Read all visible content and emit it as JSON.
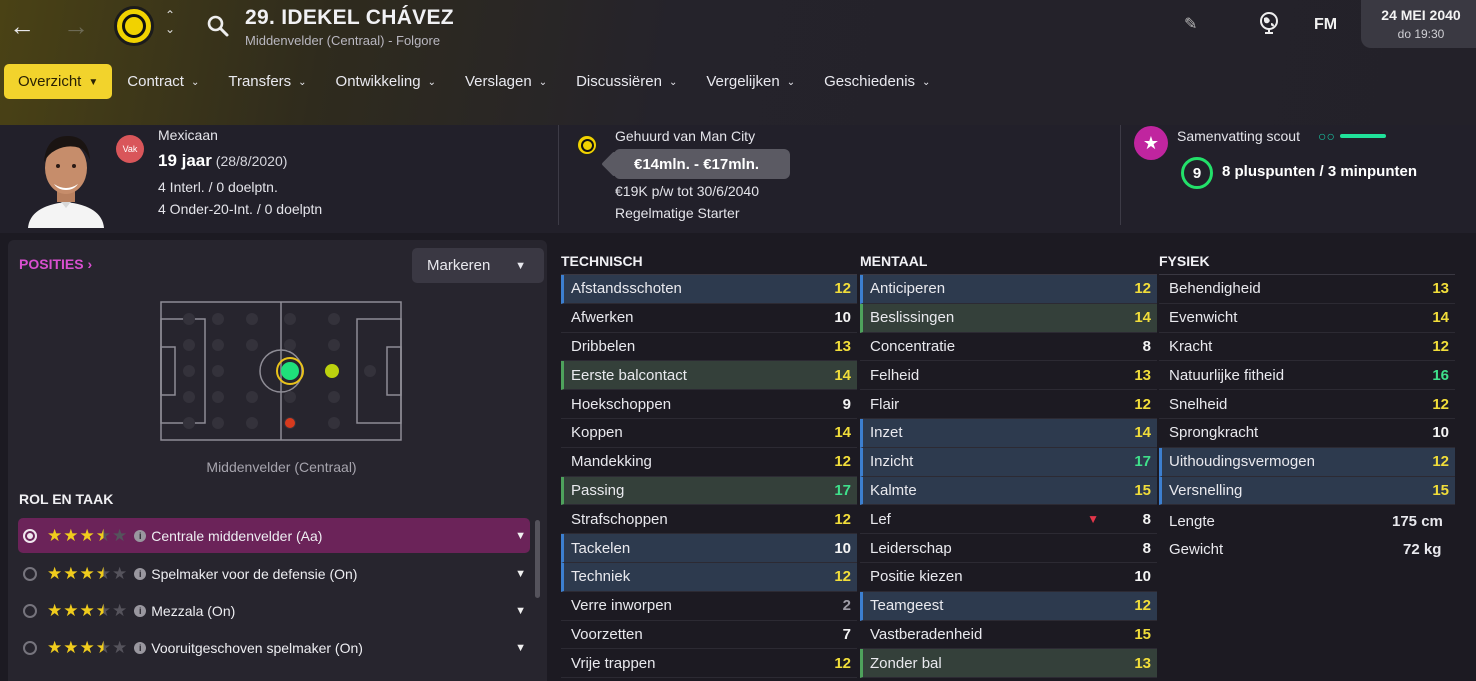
{
  "header": {
    "player_name": "29. IDEKEL CHÁVEZ",
    "player_sub": "Middenvelder (Centraal) - Folgore",
    "fm_logo": "FM",
    "date": "24 MEI 2040",
    "day_time": "do 19:30"
  },
  "nav": [
    {
      "label": "Overzicht",
      "active": true
    },
    {
      "label": "Contract"
    },
    {
      "label": "Transfers"
    },
    {
      "label": "Ontwikkeling"
    },
    {
      "label": "Verslagen"
    },
    {
      "label": "Discussiëren"
    },
    {
      "label": "Vergelijken"
    },
    {
      "label": "Geschiedenis"
    }
  ],
  "profile": {
    "vak_badge": "Vak",
    "nationality": "Mexicaan",
    "age": "19 jaar",
    "birth": "(28/8/2020)",
    "intl": "4 Interl. / 0 doelptn.",
    "u20": "4 Onder-20-Int. / 0 doelptn",
    "loan": "Gehuurd van Man City",
    "value": "€14mln. - €17mln.",
    "wage": "€19K p/w tot 30/6/2040",
    "status": "Regelmatige Starter",
    "scout_title": "Samenvatting scout",
    "scout_score": "9",
    "pros_cons": "8 pluspunten / 3 minpunten"
  },
  "positions": {
    "title": "POSITIES",
    "mark_button": "Markeren",
    "caption": "Middenvelder (Centraal)"
  },
  "roles": {
    "title": "ROL EN TAAK",
    "items": [
      {
        "label": "Centrale middenvelder (Aa)",
        "stars": 3.5,
        "selected": true
      },
      {
        "label": "Spelmaker voor de defensie (On)",
        "stars": 3.5
      },
      {
        "label": "Mezzala (On)",
        "stars": 3.5
      },
      {
        "label": "Vooruitgeschoven spelmaker (On)",
        "stars": 3.5
      }
    ]
  },
  "attributes": {
    "technisch": {
      "title": "TECHNISCH",
      "rows": [
        {
          "name": "Afstandsschoten",
          "value": "12",
          "hl": "blue",
          "c": "y"
        },
        {
          "name": "Afwerken",
          "value": "10",
          "c": "w"
        },
        {
          "name": "Dribbelen",
          "value": "13",
          "c": "y"
        },
        {
          "name": "Eerste balcontact",
          "value": "14",
          "hl": "green",
          "c": "y"
        },
        {
          "name": "Hoekschoppen",
          "value": "9",
          "c": "w"
        },
        {
          "name": "Koppen",
          "value": "14",
          "c": "y"
        },
        {
          "name": "Mandekking",
          "value": "12",
          "c": "y"
        },
        {
          "name": "Passing",
          "value": "17",
          "hl": "green",
          "c": "g"
        },
        {
          "name": "Strafschoppen",
          "value": "12",
          "c": "y"
        },
        {
          "name": "Tackelen",
          "value": "10",
          "hl": "blue",
          "c": "w"
        },
        {
          "name": "Techniek",
          "value": "12",
          "hl": "blue",
          "c": "y"
        },
        {
          "name": "Verre inworpen",
          "value": "2",
          "c": "grey"
        },
        {
          "name": "Voorzetten",
          "value": "7",
          "c": "w"
        },
        {
          "name": "Vrije trappen",
          "value": "12",
          "c": "y"
        }
      ]
    },
    "mentaal": {
      "title": "MENTAAL",
      "rows": [
        {
          "name": "Anticiperen",
          "value": "12",
          "hl": "blue",
          "c": "y"
        },
        {
          "name": "Beslissingen",
          "value": "14",
          "hl": "green",
          "c": "y"
        },
        {
          "name": "Concentratie",
          "value": "8",
          "c": "w"
        },
        {
          "name": "Felheid",
          "value": "13",
          "c": "y"
        },
        {
          "name": "Flair",
          "value": "12",
          "c": "y"
        },
        {
          "name": "Inzet",
          "value": "14",
          "hl": "blue",
          "c": "y"
        },
        {
          "name": "Inzicht",
          "value": "17",
          "hl": "blue",
          "c": "g"
        },
        {
          "name": "Kalmte",
          "value": "15",
          "hl": "blue",
          "c": "y"
        },
        {
          "name": "Lef",
          "value": "8",
          "c": "w",
          "arrow": "down"
        },
        {
          "name": "Leiderschap",
          "value": "8",
          "c": "w"
        },
        {
          "name": "Positie kiezen",
          "value": "10",
          "c": "w"
        },
        {
          "name": "Teamgeest",
          "value": "12",
          "hl": "blue",
          "c": "y"
        },
        {
          "name": "Vastberadenheid",
          "value": "15",
          "c": "y"
        },
        {
          "name": "Zonder bal",
          "value": "13",
          "hl": "green",
          "c": "y"
        }
      ]
    },
    "fysiek": {
      "title": "FYSIEK",
      "rows": [
        {
          "name": "Behendigheid",
          "value": "13",
          "c": "y"
        },
        {
          "name": "Evenwicht",
          "value": "14",
          "c": "y"
        },
        {
          "name": "Kracht",
          "value": "12",
          "c": "y"
        },
        {
          "name": "Natuurlijke fitheid",
          "value": "16",
          "c": "g"
        },
        {
          "name": "Snelheid",
          "value": "12",
          "c": "y"
        },
        {
          "name": "Sprongkracht",
          "value": "10",
          "c": "w"
        },
        {
          "name": "Uithoudingsvermogen",
          "value": "12",
          "hl": "blue",
          "c": "y"
        },
        {
          "name": "Versnelling",
          "value": "15",
          "hl": "blue",
          "c": "y"
        }
      ],
      "height_label": "Lengte",
      "height_value": "175 cm",
      "weight_label": "Gewicht",
      "weight_value": "72 kg"
    }
  }
}
